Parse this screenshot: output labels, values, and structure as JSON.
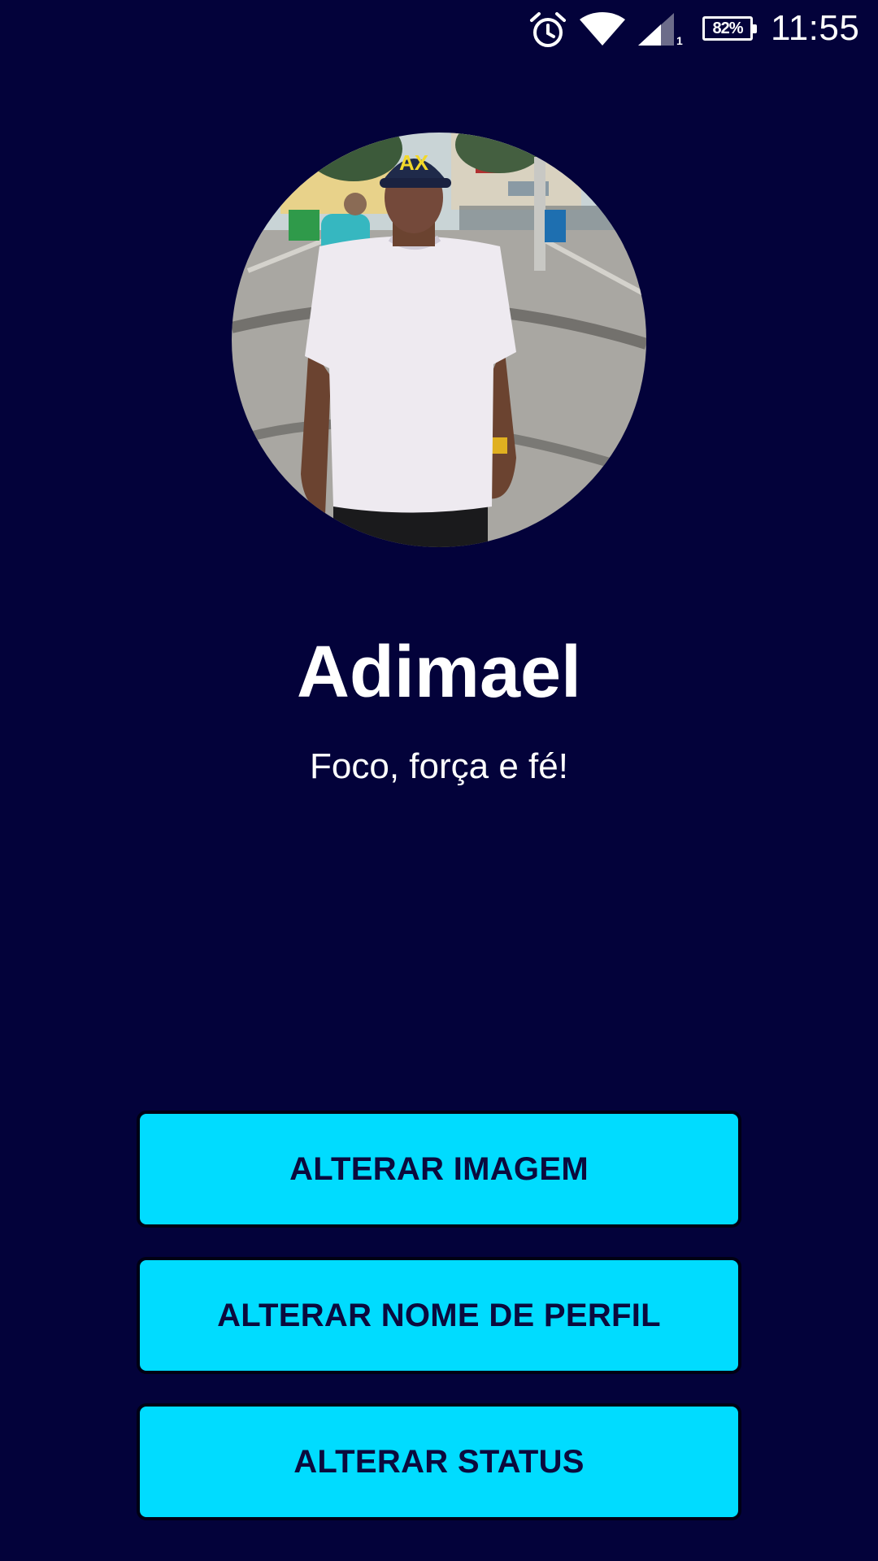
{
  "status_bar": {
    "time": "11:55",
    "battery": "82%",
    "sim_slot": "1",
    "icons": [
      "alarm-icon",
      "wifi-icon",
      "cell-signal-icon",
      "battery-icon"
    ]
  },
  "profile": {
    "name": "Adimael",
    "status": "Foco, força e fé!"
  },
  "buttons": {
    "change_image": "ALTERAR IMAGEM",
    "change_name": "ALTERAR NOME DE PERFIL",
    "change_status": "ALTERAR STATUS"
  },
  "colors": {
    "background": "#03023a",
    "button": "#00dcff",
    "button_text": "#0b0a3d",
    "text": "#ffffff"
  }
}
